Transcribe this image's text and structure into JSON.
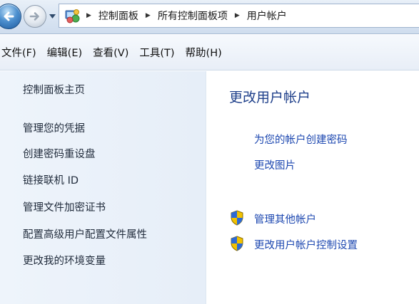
{
  "address_bar": {
    "breadcrumbs": [
      "控制面板",
      "所有控制面板项",
      "用户帐户"
    ],
    "back_icon": "back-arrow-icon",
    "forward_icon": "forward-arrow-icon",
    "history_icon": "dropdown-arrow-icon",
    "location_icon": "control-panel-icon"
  },
  "menu": {
    "items": [
      "文件(F)",
      "编辑(E)",
      "查看(V)",
      "工具(T)",
      "帮助(H)"
    ]
  },
  "left_pane": {
    "home": "控制面板主页",
    "links": [
      "管理您的凭据",
      "创建密码重设盘",
      "链接联机 ID",
      "管理文件加密证书",
      "配置高级用户配置文件属性",
      "更改我的环境变量"
    ]
  },
  "main": {
    "title": "更改用户帐户",
    "links": [
      "为您的帐户创建密码",
      "更改图片"
    ],
    "admin_links": [
      "管理其他帐户",
      "更改用户帐户控制设置"
    ],
    "admin_icon": "uac-shield-icon"
  },
  "colors": {
    "link": "#1c47b0",
    "title": "#1e3f8a",
    "pane_bg": "#eef4fb"
  }
}
